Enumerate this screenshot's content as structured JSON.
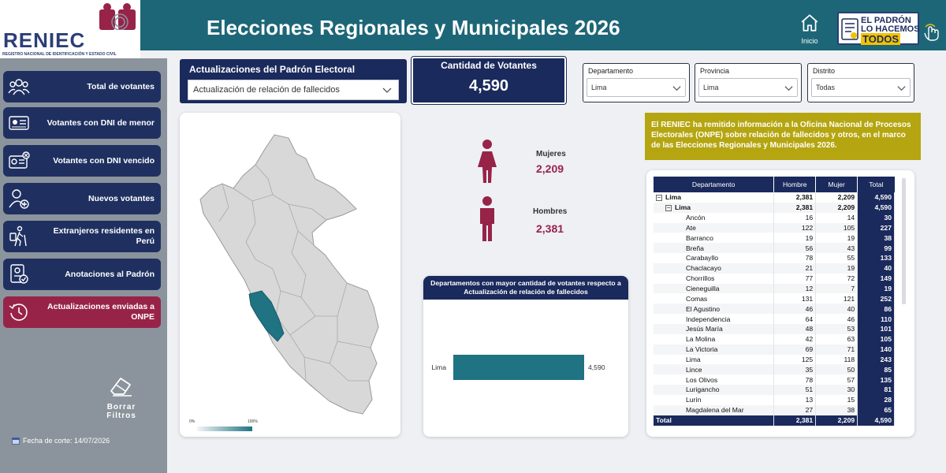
{
  "header": {
    "title": "Elecciones Regionales y Municipales 2026",
    "logo_text": "RENIEC",
    "logo_subtitle": "REGISTRO NACIONAL DE IDENTIFICACIÓN Y ESTADO CIVIL",
    "home_label": "Inicio",
    "badge_line1": "EL PADRÓN",
    "badge_line2": "LO HACEMOS",
    "badge_line3": "TODOS",
    "color": "#1d6677"
  },
  "sidebar": {
    "items": [
      {
        "label": "Total de votantes",
        "icon": "people-group-icon"
      },
      {
        "label": "Votantes con DNI de menor",
        "icon": "id-card-icon"
      },
      {
        "label": "Votantes con DNI vencido",
        "icon": "expired-id-icon"
      },
      {
        "label": "Nuevos votantes",
        "icon": "add-user-icon"
      },
      {
        "label": "Extranjeros residentes en Perú",
        "icon": "traveler-icon"
      },
      {
        "label": "Anotaciones al Padrón",
        "icon": "document-check-icon"
      },
      {
        "label": "Actualizaciones enviadas a ONPE",
        "icon": "history-icon",
        "active": true
      }
    ],
    "clear_filters": "Borrar Filtros",
    "cutoff_date": "Fecha de corte: 14/07/2026"
  },
  "selector": {
    "title": "Actualizaciones del Padrón Electoral",
    "value": "Actualización de relación de fallecidos"
  },
  "voters": {
    "title": "Cantidad de Votantes",
    "value": "4,590"
  },
  "filters": [
    {
      "label": "Departamento",
      "value": "Lima"
    },
    {
      "label": "Provincia",
      "value": "Lima"
    },
    {
      "label": "Distrito",
      "value": "Todas"
    }
  ],
  "map": {
    "legend_min": "0%",
    "legend_max": "100%",
    "highlight_color": "#1f7383"
  },
  "gender": {
    "women_label": "Mujeres",
    "women_value": "2,209",
    "men_label": "Hombres",
    "men_value": "2,381",
    "color": "#982349"
  },
  "notice": "El RENIEC ha remitido información a la Oficina Nacional de Procesos Electorales (ONPE) sobre relación de fallecidos y otros, en el marco de las Elecciones Regionales y Municipales 2026.",
  "chart_data": {
    "type": "bar",
    "orientation": "horizontal",
    "title": "Departamentos con mayor cantidad de votantes respecto a Actualización de relación de fallecidos",
    "categories": [
      "Lima"
    ],
    "values": [
      4590
    ],
    "value_labels": [
      "4,590"
    ],
    "xlim": [
      0,
      4590
    ],
    "grid": false,
    "bar_color": "#1f7383"
  },
  "table": {
    "headers": [
      "Departamento",
      "Hombre",
      "Mujer",
      "Total"
    ],
    "dept_row": {
      "name": "Lima",
      "hombre": "2,381",
      "mujer": "2,209",
      "total": "4,590"
    },
    "prov_row": {
      "name": "Lima",
      "hombre": "2,381",
      "mujer": "2,209",
      "total": "4,590"
    },
    "rows": [
      {
        "name": "Ancón",
        "hombre": "16",
        "mujer": "14",
        "total": "30"
      },
      {
        "name": "Ate",
        "hombre": "122",
        "mujer": "105",
        "total": "227"
      },
      {
        "name": "Barranco",
        "hombre": "19",
        "mujer": "19",
        "total": "38"
      },
      {
        "name": "Breña",
        "hombre": "56",
        "mujer": "43",
        "total": "99"
      },
      {
        "name": "Carabayllo",
        "hombre": "78",
        "mujer": "55",
        "total": "133"
      },
      {
        "name": "Chaclacayo",
        "hombre": "21",
        "mujer": "19",
        "total": "40"
      },
      {
        "name": "Chorrillos",
        "hombre": "77",
        "mujer": "72",
        "total": "149"
      },
      {
        "name": "Cieneguilla",
        "hombre": "12",
        "mujer": "7",
        "total": "19"
      },
      {
        "name": "Comas",
        "hombre": "131",
        "mujer": "121",
        "total": "252"
      },
      {
        "name": "El Agustino",
        "hombre": "46",
        "mujer": "40",
        "total": "86"
      },
      {
        "name": "Independencia",
        "hombre": "64",
        "mujer": "46",
        "total": "110"
      },
      {
        "name": "Jesús María",
        "hombre": "48",
        "mujer": "53",
        "total": "101"
      },
      {
        "name": "La Molina",
        "hombre": "42",
        "mujer": "63",
        "total": "105"
      },
      {
        "name": "La Victoria",
        "hombre": "69",
        "mujer": "71",
        "total": "140"
      },
      {
        "name": "Lima",
        "hombre": "125",
        "mujer": "118",
        "total": "243"
      },
      {
        "name": "Lince",
        "hombre": "35",
        "mujer": "50",
        "total": "85"
      },
      {
        "name": "Los Olivos",
        "hombre": "78",
        "mujer": "57",
        "total": "135"
      },
      {
        "name": "Lurigancho",
        "hombre": "51",
        "mujer": "30",
        "total": "81"
      },
      {
        "name": "Lurín",
        "hombre": "13",
        "mujer": "15",
        "total": "28"
      },
      {
        "name": "Magdalena del Mar",
        "hombre": "27",
        "mujer": "38",
        "total": "65"
      }
    ],
    "footer": {
      "name": "Total",
      "hombre": "2,381",
      "mujer": "2,209",
      "total": "4,590"
    }
  }
}
